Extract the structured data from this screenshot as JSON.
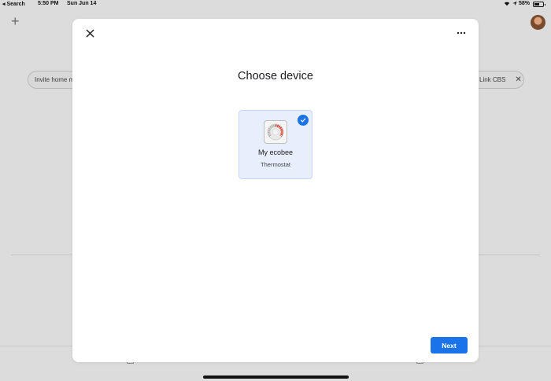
{
  "status_bar": {
    "back_label": "◂ Search",
    "time": "5:50 PM",
    "date": "Sun Jun 14",
    "battery_percent": "58%"
  },
  "background": {
    "chips": {
      "invite_label": "Invite home m",
      "link_label": "Link CBS"
    }
  },
  "modal": {
    "title": "Choose device",
    "device": {
      "name": "My ecobee",
      "type": "Thermostat",
      "selected": true
    },
    "next_label": "Next"
  },
  "colors": {
    "accent": "#1a73e8",
    "selected_card_bg": "#e8effc",
    "thermostat_red": "#d93025"
  }
}
